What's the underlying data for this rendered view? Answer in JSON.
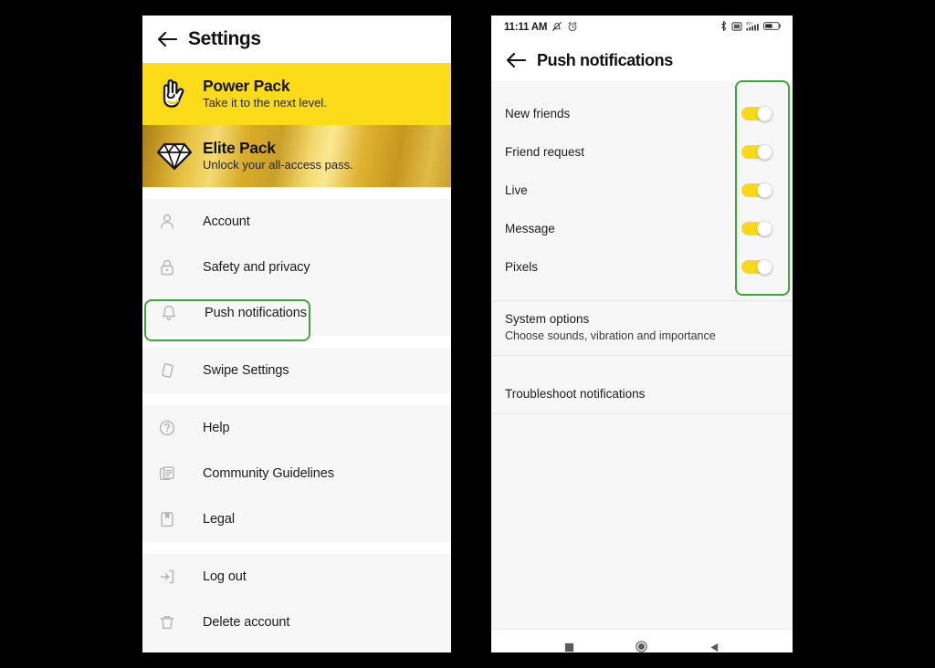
{
  "background_color": "#000000",
  "accent_yellow": "#fcdb18",
  "highlight_green": "#3aa83a",
  "left_phone": {
    "header": {
      "back_icon": "back-arrow-icon",
      "title": "Settings"
    },
    "promos": [
      {
        "icon": "rock-hand-icon",
        "title": "Power Pack",
        "subtitle": "Take it to the next level.",
        "background": "#fcdb18"
      },
      {
        "icon": "diamond-icon",
        "title": "Elite Pack",
        "subtitle": "Unlock your all-access pass.",
        "background": "gold-gradient"
      }
    ],
    "menu_groups": [
      {
        "items": [
          {
            "icon": "person-icon",
            "label": "Account",
            "highlighted": false
          },
          {
            "icon": "lock-icon",
            "label": "Safety and privacy",
            "highlighted": false
          },
          {
            "icon": "bell-icon",
            "label": "Push notifications",
            "highlighted": true
          }
        ]
      },
      {
        "items": [
          {
            "icon": "swipe-card-icon",
            "label": "Swipe Settings",
            "highlighted": false
          }
        ]
      },
      {
        "items": [
          {
            "icon": "question-circle-icon",
            "label": "Help",
            "highlighted": false
          },
          {
            "icon": "document-stack-icon",
            "label": "Community Guidelines",
            "highlighted": false
          },
          {
            "icon": "book-bookmark-icon",
            "label": "Legal",
            "highlighted": false
          }
        ]
      },
      {
        "items": [
          {
            "icon": "logout-icon",
            "label": "Log out",
            "highlighted": false
          },
          {
            "icon": "trash-icon",
            "label": "Delete account",
            "highlighted": false
          }
        ]
      }
    ]
  },
  "right_phone": {
    "status_bar": {
      "time": "11:11 AM",
      "left_icons": [
        "mute-bell-icon",
        "alarm-clock-icon"
      ],
      "right_icons": [
        "bluetooth-icon",
        "screenshot-icon",
        "signal-4g-icon",
        "battery-icon"
      ],
      "network_label": "4G+"
    },
    "header": {
      "back_icon": "back-arrow-icon",
      "title": "Push notifications"
    },
    "toggles": [
      {
        "label": "New friends",
        "state": "on"
      },
      {
        "label": "Friend request",
        "state": "on"
      },
      {
        "label": "Live",
        "state": "on"
      },
      {
        "label": "Message",
        "state": "on"
      },
      {
        "label": "Pixels",
        "state": "on"
      }
    ],
    "options": [
      {
        "title": "System options",
        "subtitle": "Choose sounds, vibration and importance"
      },
      {
        "title": "Troubleshoot notifications",
        "subtitle": ""
      }
    ],
    "nav_bar": {
      "buttons": [
        "recents-square-icon",
        "home-circle-icon",
        "back-triangle-icon"
      ]
    }
  }
}
